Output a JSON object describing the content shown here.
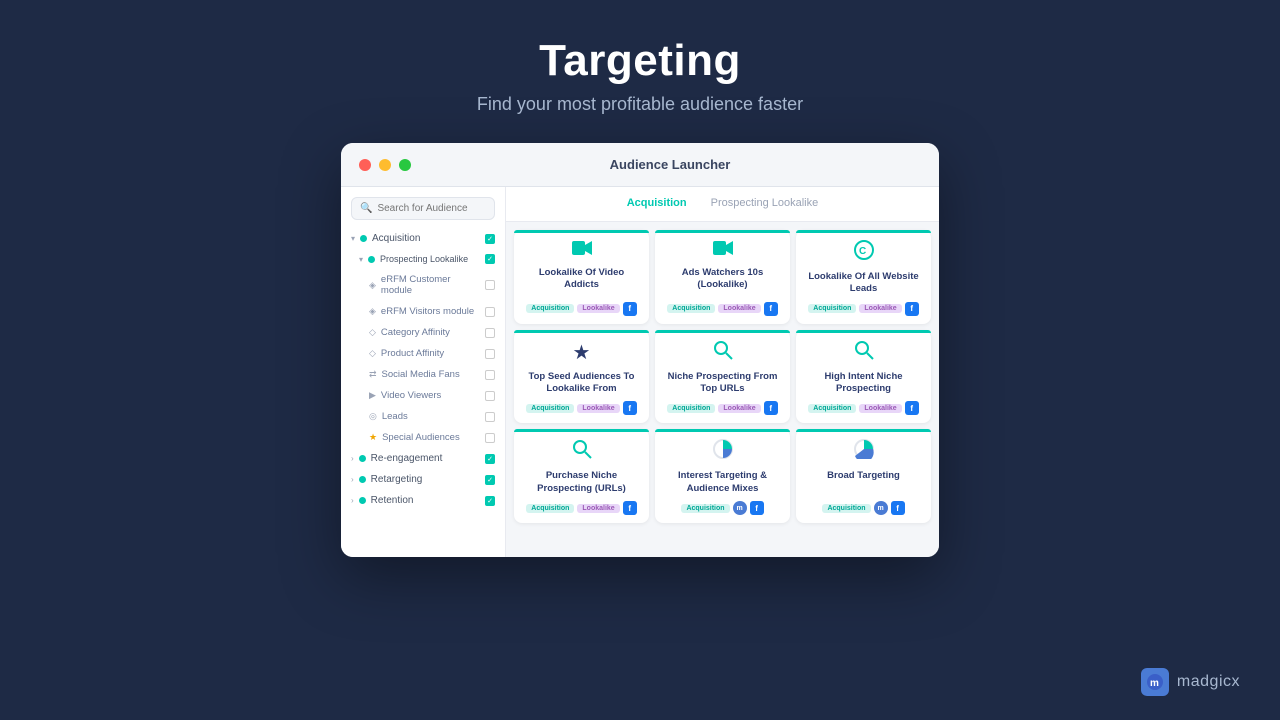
{
  "page": {
    "title": "Targeting",
    "subtitle": "Find your most profitable audience faster"
  },
  "window": {
    "title": "Audience Launcher"
  },
  "tabs": [
    {
      "label": "Acquisition",
      "active": true
    },
    {
      "label": "Prospecting Lookalike",
      "active": false
    }
  ],
  "sidebar": {
    "search_placeholder": "Search for Audience",
    "items": [
      {
        "label": "Acquisition",
        "level": 0,
        "checked": true,
        "dot": "teal"
      },
      {
        "label": "Prospecting Lookalike",
        "level": 1,
        "checked": true,
        "dot": "teal"
      },
      {
        "label": "eRFM Customer module",
        "level": 2,
        "checked": false,
        "dot": "gray"
      },
      {
        "label": "eRFM Visitors module",
        "level": 2,
        "checked": false,
        "dot": "gray"
      },
      {
        "label": "Category Affinity",
        "level": 2,
        "checked": false,
        "dot": "gray"
      },
      {
        "label": "Product Affinity",
        "level": 2,
        "checked": false,
        "dot": "gray"
      },
      {
        "label": "Social Media Fans",
        "level": 2,
        "checked": false,
        "dot": "gray"
      },
      {
        "label": "Video Viewers",
        "level": 2,
        "checked": false,
        "dot": "gray"
      },
      {
        "label": "Leads",
        "level": 2,
        "checked": false,
        "dot": "gray"
      },
      {
        "label": "Special Audiences",
        "level": 2,
        "checked": false,
        "dot": "star"
      },
      {
        "label": "Re-engagement",
        "level": 0,
        "checked": true,
        "dot": "teal"
      },
      {
        "label": "Retargeting",
        "level": 0,
        "checked": true,
        "dot": "teal"
      },
      {
        "label": "Retention",
        "level": 0,
        "checked": true,
        "dot": "teal"
      }
    ]
  },
  "cards": [
    {
      "icon": "🎥",
      "title": "Lookalike Of Video Addicts",
      "badges": [
        "Acquisition",
        "Lookalike"
      ],
      "platform": "fb"
    },
    {
      "icon": "🎥",
      "title": "Ads Watchers 10s (Lookalike)",
      "badges": [
        "Acquisition",
        "Lookalike"
      ],
      "platform": "fb"
    },
    {
      "icon": "c",
      "title": "Lookalike Of All Website Leads",
      "badges": [
        "Acquisition",
        "Lookalike"
      ],
      "platform": "fb"
    },
    {
      "icon": "⭐",
      "title": "Top Seed Audiences To Lookalike From",
      "badges": [
        "Acquisition",
        "Lookalike"
      ],
      "platform": "fb"
    },
    {
      "icon": "🔍",
      "title": "Niche Prospecting From Top URLs",
      "badges": [
        "Acquisition",
        "Lookalike"
      ],
      "platform": "fb"
    },
    {
      "icon": "🔍",
      "title": "High Intent Niche Prospecting",
      "badges": [
        "Acquisition",
        "Lookalike"
      ],
      "platform": "fb"
    },
    {
      "icon": "🔍",
      "title": "Purchase Niche Prospecting (URLs)",
      "badges": [
        "Acquisition",
        "Lookalike"
      ],
      "platform": "fb"
    },
    {
      "icon": "🎯",
      "title": "Interest Targeting & Audience Mixes",
      "badges": [
        "Acquisition"
      ],
      "platform": "multi"
    },
    {
      "icon": "🎯",
      "title": "Broad Targeting",
      "badges": [
        "Acquisition"
      ],
      "platform": "multi"
    }
  ],
  "branding": {
    "logo_text": "m",
    "name": "madgicx"
  }
}
